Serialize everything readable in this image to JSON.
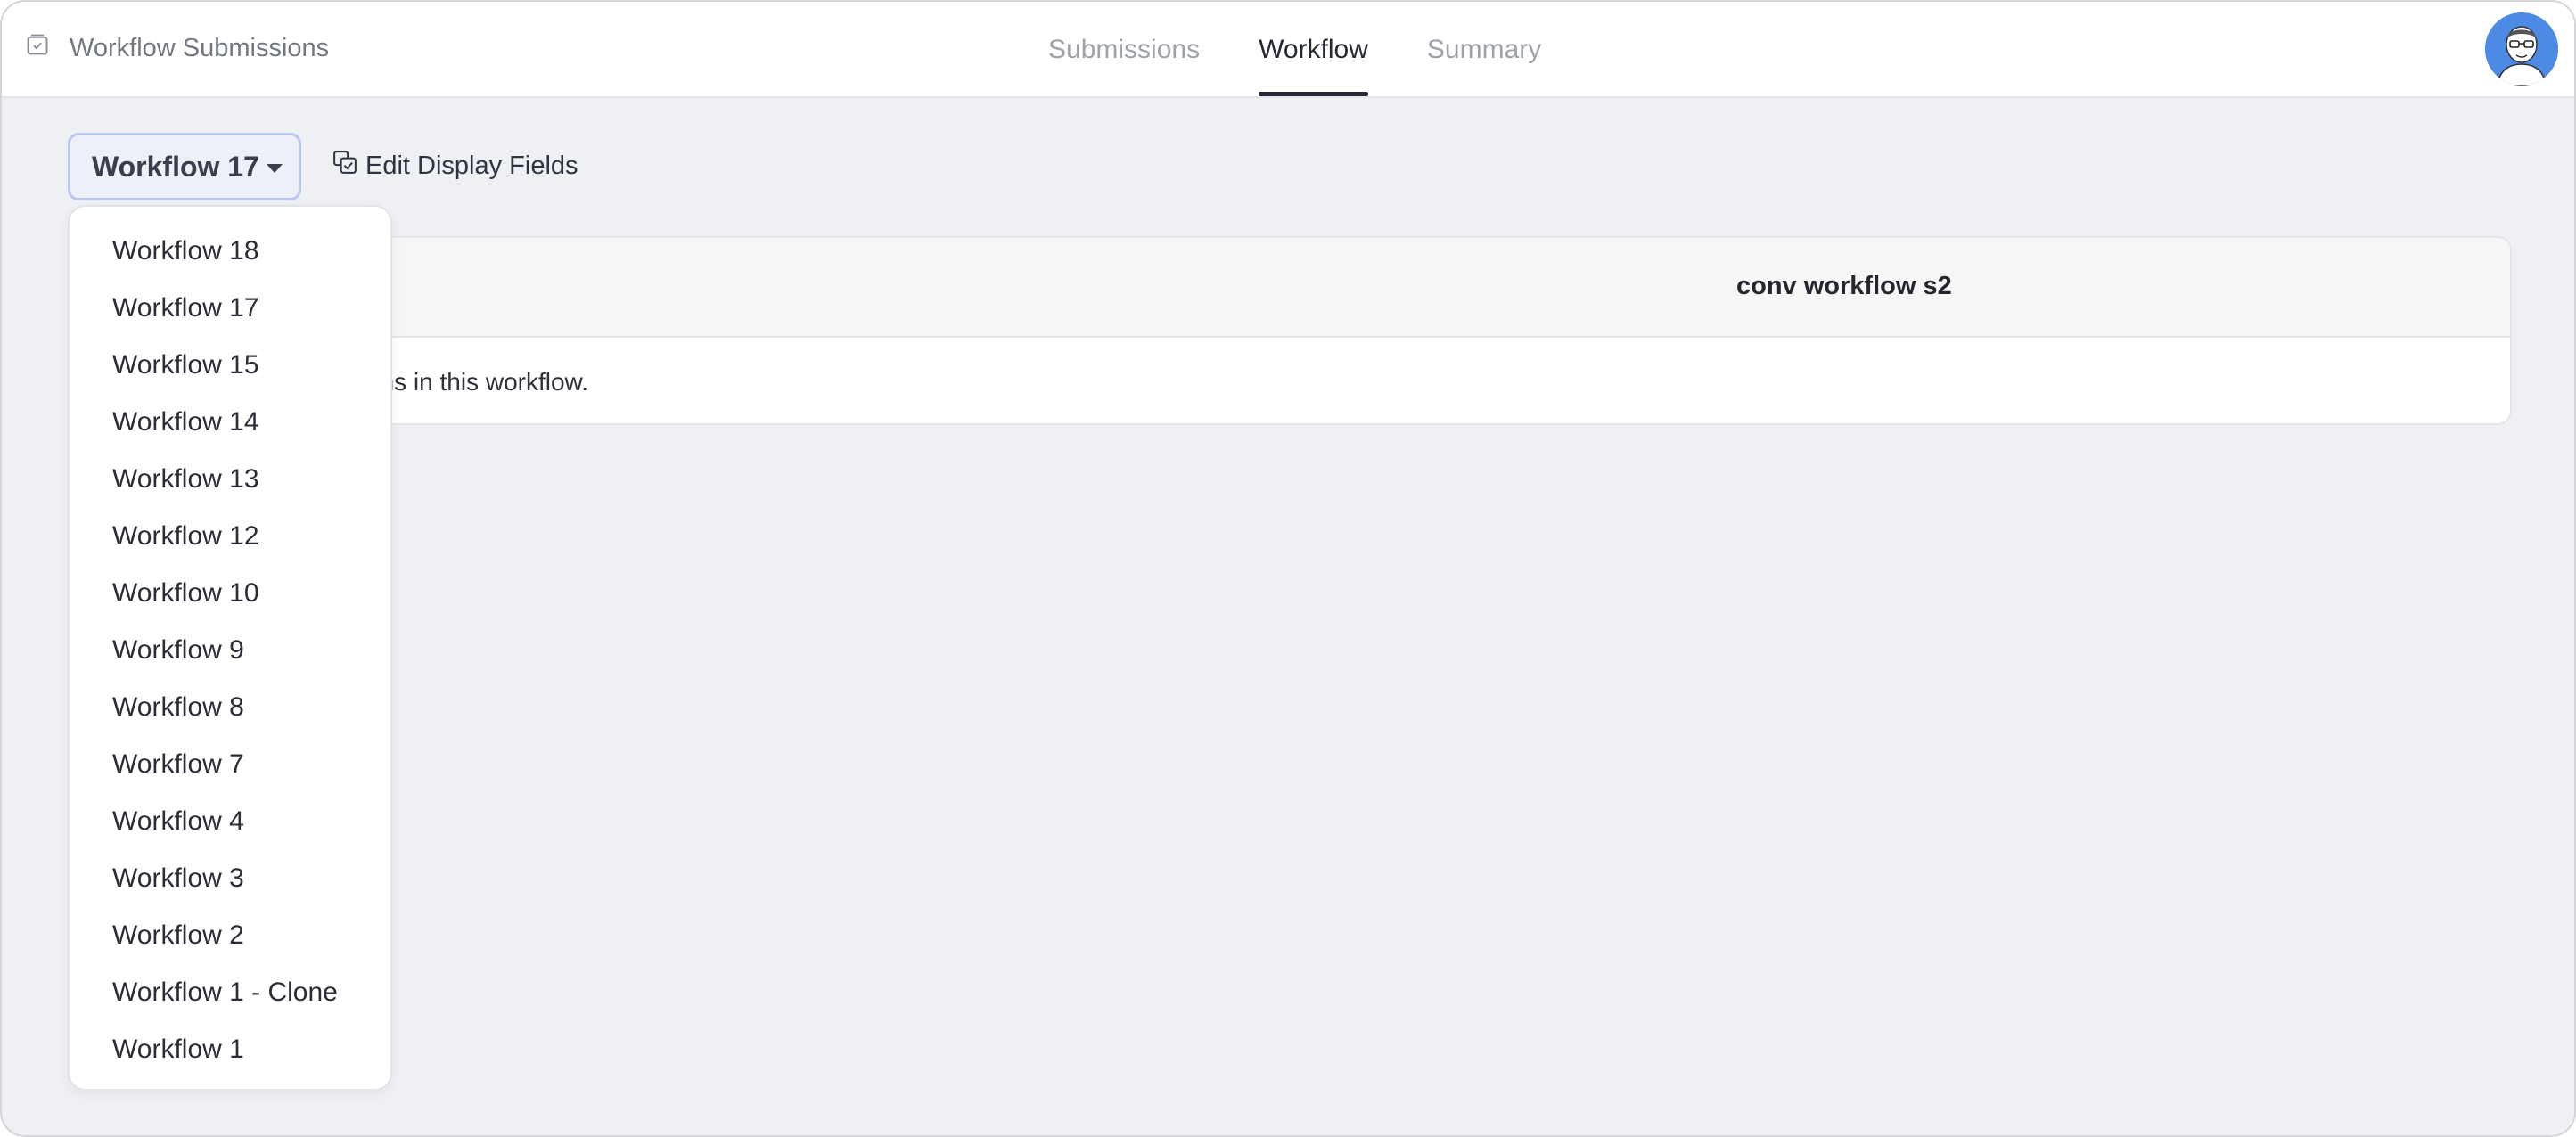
{
  "app": {
    "title": "Workflow Submissions",
    "icon": "inbox-check-icon"
  },
  "tabs": [
    {
      "label": "Submissions",
      "active": false
    },
    {
      "label": "Workflow",
      "active": true
    },
    {
      "label": "Summary",
      "active": false
    }
  ],
  "toolbar": {
    "selected_workflow": "Workflow 17",
    "edit_fields_label": "Edit Display Fields",
    "edit_fields_icon": "edit-fields-icon"
  },
  "table": {
    "column_header": "conv workflow s2",
    "empty_message": "There are no submissions in this workflow."
  },
  "dropdown": {
    "options": [
      "Workflow 18",
      "Workflow 17",
      "Workflow 15",
      "Workflow 14",
      "Workflow 13",
      "Workflow 12",
      "Workflow 10",
      "Workflow 9",
      "Workflow 8",
      "Workflow 7",
      "Workflow 4",
      "Workflow 3",
      "Workflow 2",
      "Workflow 1 - Clone",
      "Workflow 1"
    ]
  },
  "colors": {
    "accent": "#252836",
    "page_bg": "#eff0f4",
    "avatar_bg": "#4d8ae6"
  }
}
